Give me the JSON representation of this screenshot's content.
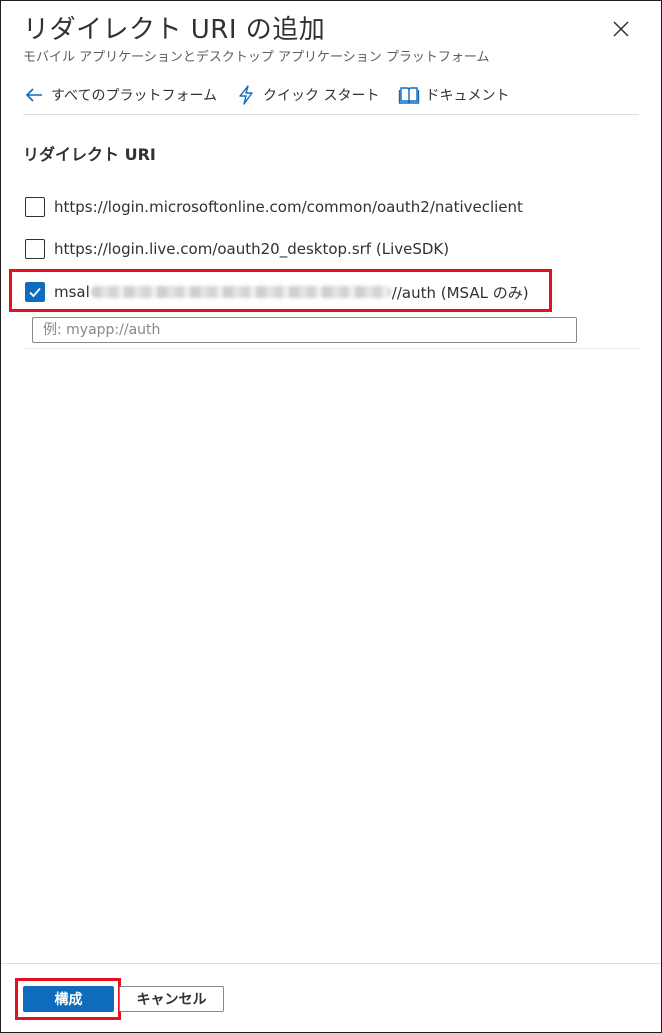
{
  "header": {
    "title": "リダイレクト URI の追加",
    "subtitle": "モバイル アプリケーションとデスクトップ アプリケーション プラットフォーム"
  },
  "toolbar": {
    "all_platforms": "すべてのプラットフォーム",
    "quick_start": "クイック スタート",
    "documents": "ドキュメント"
  },
  "section": {
    "heading": "リダイレクト URI"
  },
  "options": [
    {
      "label": "https://login.microsoftonline.com/common/oauth2/nativeclient",
      "checked": false
    },
    {
      "label": "https://login.live.com/oauth20_desktop.srf (LiveSDK)",
      "checked": false
    },
    {
      "prefix": "msal",
      "suffix": "//auth (MSAL のみ)",
      "checked": true
    }
  ],
  "custom_uri": {
    "placeholder": "例: myapp://auth",
    "value": ""
  },
  "footer": {
    "configure_label": "構成",
    "cancel_label": "キャンセル"
  },
  "colors": {
    "accent": "#0f6cbd",
    "highlight": "#e3101f"
  }
}
